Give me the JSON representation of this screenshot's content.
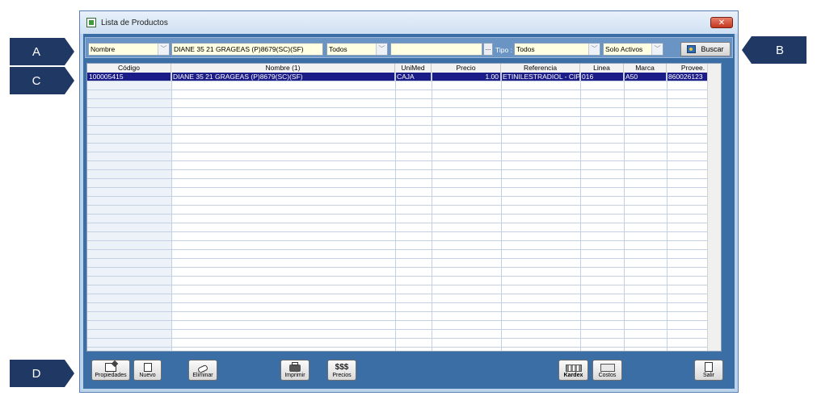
{
  "callouts": {
    "a": "A",
    "b": "B",
    "c": "C",
    "d": "D"
  },
  "window": {
    "title": "Lista de Productos",
    "close_glyph": "✕"
  },
  "filters": {
    "field_select": "Nombre",
    "search_value": "DIANE 35 21 GRAGEAS (P)8679(SC)(SF)",
    "scope_select": "Todos",
    "extra_value": "",
    "ellipsis": "...",
    "tipo_label": "Tipo :",
    "tipo_select": "Todos",
    "status_select": "Solo Activos",
    "search_button": "Buscar"
  },
  "grid": {
    "columns": [
      "Código",
      "Nombre (1)",
      "UniMed",
      "Precio",
      "Referencia",
      "Linea",
      "Marca",
      "Provee."
    ],
    "rows": [
      {
        "codigo": "100005415",
        "nombre": "DIANE 35 21 GRAGEAS (P)8679(SC)(SF)",
        "unimed": "CAJA",
        "precio": "1.00",
        "referencia": "ETINILESTRADIOL - CIPROTERONA",
        "linea": "016",
        "marca": "A50",
        "provee": "860026123"
      }
    ]
  },
  "toolbar": {
    "propiedades": "Propiedades",
    "nuevo": "Nuevo",
    "eliminar": "Eliminar",
    "imprimir": "Imprimir",
    "precios_icon": "$$$",
    "precios": "Precios",
    "kardex": "Kardex",
    "costos": "Costos",
    "salir": "Salir"
  },
  "icons": {
    "propiedades": "edit-icon",
    "nuevo": "new-document-icon",
    "eliminar": "eraser-icon",
    "imprimir": "printer-icon",
    "precios": "dollar-icon",
    "kardex": "kardex-icon",
    "costos": "costs-icon",
    "salir": "exit-icon",
    "buscar": "search-image-icon"
  }
}
